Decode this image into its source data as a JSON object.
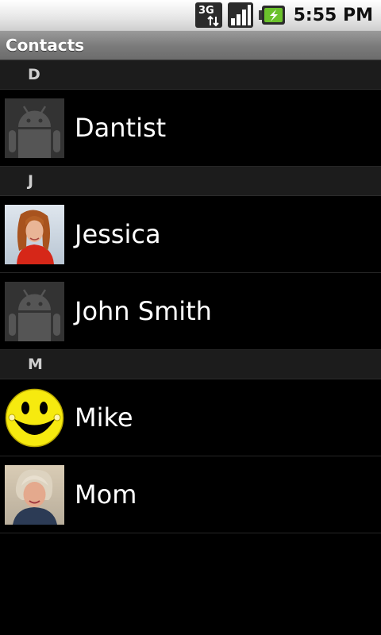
{
  "status_bar": {
    "network": "3G",
    "time": "5:55 PM",
    "icons": [
      "3g-data-icon",
      "signal-strength-icon",
      "battery-charging-icon"
    ]
  },
  "title_bar": {
    "title": "Contacts"
  },
  "sections": [
    {
      "letter": "D",
      "contacts": [
        {
          "name": "Dantist",
          "avatar": "android-default-avatar"
        }
      ]
    },
    {
      "letter": "J",
      "contacts": [
        {
          "name": "Jessica",
          "avatar": "photo-woman-red-jacket"
        },
        {
          "name": "John Smith",
          "avatar": "android-default-avatar"
        }
      ]
    },
    {
      "letter": "M",
      "contacts": [
        {
          "name": "Mike",
          "avatar": "smiley-face-avatar"
        },
        {
          "name": "Mom",
          "avatar": "photo-woman-blonde"
        }
      ]
    }
  ],
  "colors": {
    "background": "#000000",
    "section_header_bg": "#1c1c1c",
    "title_bar_bg": "#7a7a7a",
    "status_bar_bg": "#e6e6e6"
  }
}
